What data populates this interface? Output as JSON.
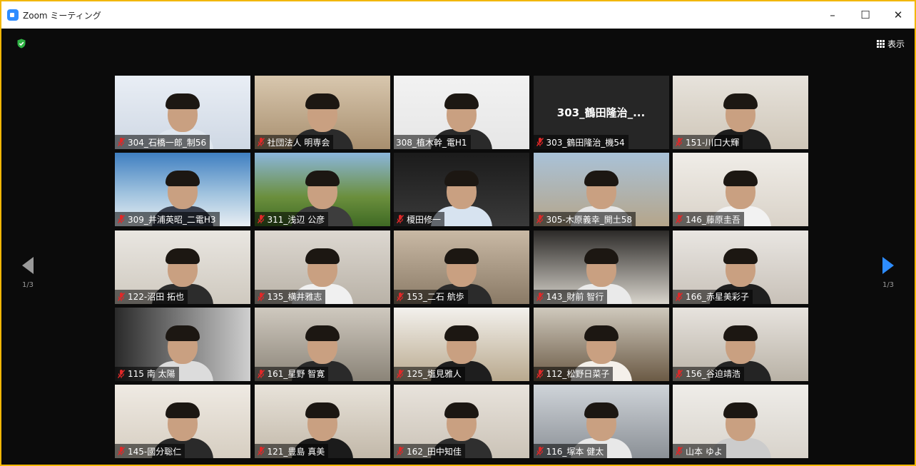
{
  "window": {
    "title": "Zoom ミーティング",
    "minimize": "–",
    "maximize": "☐",
    "close": "✕",
    "border_color": "#f2b705"
  },
  "toolbar": {
    "view_label": "表示"
  },
  "pagination": {
    "left_label": "1/3",
    "right_label": "1/3",
    "accent": "#2d8cff"
  },
  "tiles": [
    {
      "name": "304_石橋一郎_制56",
      "muted": true
    },
    {
      "name": "社団法人 明専会",
      "muted": true
    },
    {
      "name": "308_植木幹_電H1",
      "muted": false,
      "active": true
    },
    {
      "name": "303_鶴田隆治_機54",
      "muted": true,
      "center_name": "303_鶴田隆治_..."
    },
    {
      "name": "151-川口大輝",
      "muted": true
    },
    {
      "name": "309_井浦英昭_二電H3",
      "muted": true
    },
    {
      "name": "311_浅辺 公彦",
      "muted": true
    },
    {
      "name": "榎田修一",
      "muted": true
    },
    {
      "name": "305-木原義幸_開土58",
      "muted": true
    },
    {
      "name": "146_藤原圭吾",
      "muted": true
    },
    {
      "name": "122-沼田 拓也",
      "muted": true
    },
    {
      "name": "135_横井雅志",
      "muted": true
    },
    {
      "name": "153_二石 航歩",
      "muted": true
    },
    {
      "name": "143_財前 智行",
      "muted": true
    },
    {
      "name": "166_赤星美彩子",
      "muted": true
    },
    {
      "name": "115 南 太陽",
      "muted": true
    },
    {
      "name": "161_星野 智寛",
      "muted": true
    },
    {
      "name": "125_塩見雅人",
      "muted": true
    },
    {
      "name": "112_松野日菜子",
      "muted": true
    },
    {
      "name": "156_谷迫靖浩",
      "muted": true
    },
    {
      "name": "145-國分聡仁",
      "muted": true
    },
    {
      "name": "121_豊島 真美",
      "muted": true
    },
    {
      "name": "162_田中知佳",
      "muted": true
    },
    {
      "name": "116_塚本 健太",
      "muted": true
    },
    {
      "name": "山本 ゆよ",
      "muted": true
    }
  ]
}
